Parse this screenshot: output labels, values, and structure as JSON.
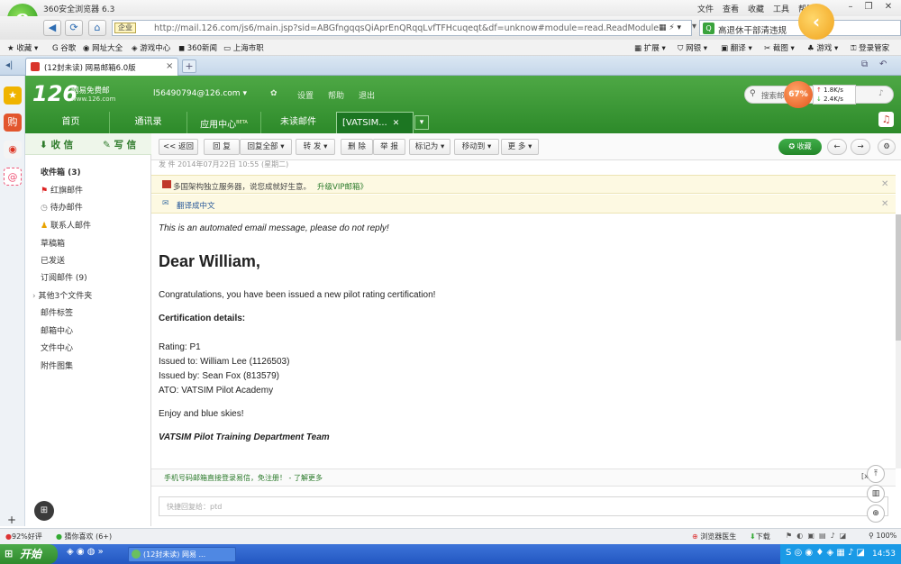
{
  "browser": {
    "title": "360安全浏览器 6.3",
    "menu": [
      "文件",
      "查看",
      "收藏",
      "工具",
      "帮助"
    ],
    "logo_letter": "e",
    "url_prefix": "企业",
    "url": "http://mail.126.com/js6/main.jsp?sid=ABGfngqqsQiAprEnQRqqLvfTFHcuqeqt&df=unknow#module=read.ReadModule%7C",
    "search_text": "高退休干部清违规",
    "bookmarks": [
      "收藏",
      "谷歌",
      "网址大全",
      "游戏中心",
      "360新闻",
      "上海市职"
    ],
    "bookmarks_right": [
      "扩展",
      "网银",
      "翻译",
      "截图",
      "游戏",
      "登录管家"
    ],
    "tab_label": "(12封未读) 网易邮箱6.0版",
    "tab_close": "×",
    "new_tab": "+"
  },
  "mail": {
    "logo": "126",
    "logo_line1": "网易免费邮",
    "logo_line2": "www.126.com",
    "account": "l56490794@126.com",
    "header_links": [
      "设置",
      "帮助",
      "退出"
    ],
    "search_placeholder": "搜索邮",
    "speed_percent": "67%",
    "speed_up": "1.8K/s",
    "speed_down": "2.4K/s",
    "tabs": [
      "首页",
      "通讯录",
      "应用中心",
      "未读邮件"
    ],
    "tab_beta": "BETA",
    "active_tab": "[VATSIM...",
    "inbox_btn": "收 信",
    "compose_btn": "写 信",
    "folders": [
      {
        "label": "收件箱 (3)"
      },
      {
        "label": "红旗邮件"
      },
      {
        "label": "待办邮件"
      },
      {
        "label": "联系人邮件"
      },
      {
        "label": "草稿箱"
      },
      {
        "label": "已发送"
      },
      {
        "label": "订阅邮件 (9)"
      },
      {
        "label": "其他3个文件夹"
      },
      {
        "label": "邮件标签"
      },
      {
        "label": "邮箱中心"
      },
      {
        "label": "文件中心"
      },
      {
        "label": "附件图集"
      }
    ],
    "toolbar": {
      "back": "<< 返回",
      "reply": "回 复",
      "reply_all": "回复全部",
      "forward": "转 发",
      "delete": "删 除",
      "report": "举 报",
      "mark": "标记为",
      "move": "移动到",
      "more": "更 多",
      "favorite": "收藏"
    },
    "meta_line": "发  件  2014年07月22日 10:55 (星期二)",
    "notice1": "多国架构独立服务器，说您成就好生意。",
    "notice1_link": "升级VIP邮箱》",
    "notice2": "翻译成中文",
    "email": {
      "auto_note": "This is an automated email message, please do not reply!",
      "greeting": "Dear William,",
      "congrats": "Congratulations, you have been issued a new pilot rating certification!",
      "details_heading": "Certification details:",
      "rating": "Rating: P1",
      "issued_to": "Issued to: William Lee (1126503)",
      "issued_by": "Issued by: Sean Fox (813579)",
      "ato": "ATO: VATSIM Pilot Academy",
      "closing": "Enjoy and blue skies!",
      "signature": "VATSIM Pilot Training Department Team"
    },
    "bottom_banner": "手机号码邮箱直接登录易信，免注册！",
    "bottom_link": "- 了解更多",
    "reply_placeholder": "快捷回复给：ptd"
  },
  "status": {
    "left": [
      "92%好评",
      "猜你喜欢 (6+)"
    ],
    "right": [
      "浏览器医生",
      "下载",
      "100%"
    ]
  },
  "taskbar": {
    "start": "开始",
    "task": "(12封未读) 网易 ...",
    "clock": "14:53"
  },
  "colors": {
    "mail_green": "#2d8a2a",
    "accent_orange": "#e4551b",
    "taskbar_blue": "#2357c1"
  }
}
